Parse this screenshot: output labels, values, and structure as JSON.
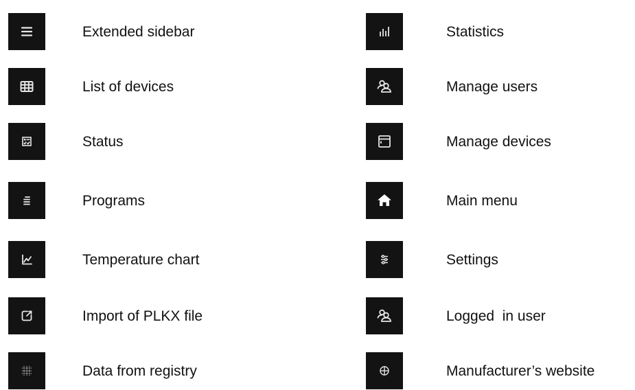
{
  "left_column": [
    {
      "label": "Extended sidebar",
      "icon": "hamburger-menu-icon"
    },
    {
      "label": "List of devices",
      "icon": "table-grid-icon"
    },
    {
      "label": "Status",
      "icon": "status-checklist-icon"
    },
    {
      "label": "Programs",
      "icon": "text-lines-icon"
    },
    {
      "label": "Temperature chart",
      "icon": "line-chart-icon"
    },
    {
      "label": "Import of PLKX file",
      "icon": "import-edit-icon"
    },
    {
      "label": "Data from registry",
      "icon": "registry-grid-icon"
    }
  ],
  "right_column": [
    {
      "label": "Statistics",
      "icon": "bar-stats-icon"
    },
    {
      "label": "Manage users",
      "icon": "users-icon"
    },
    {
      "label": "Manage devices",
      "icon": "device-window-icon"
    },
    {
      "label": "Main menu",
      "icon": "home-icon"
    },
    {
      "label": "Settings",
      "icon": "sliders-icon"
    },
    {
      "label": "Logged  in user",
      "icon": "users-icon"
    },
    {
      "label": "Manufacturer’s website",
      "icon": "globe-icon"
    }
  ],
  "colors": {
    "tile_background": "#131313",
    "icon": "#e6e6e6",
    "text": "#111111"
  }
}
